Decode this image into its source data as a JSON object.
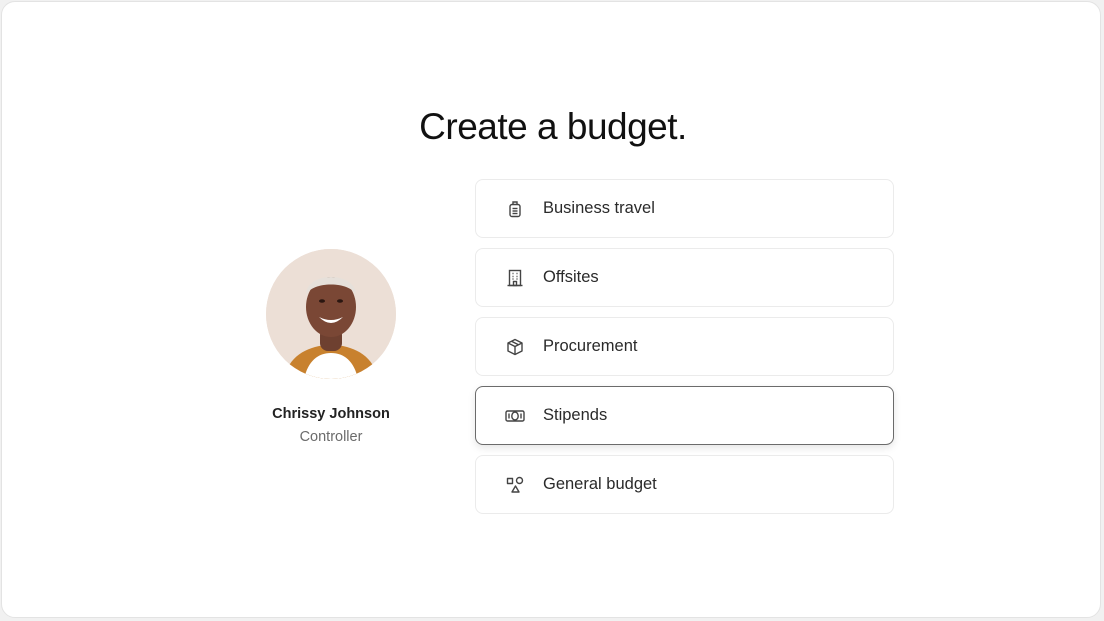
{
  "page": {
    "title": "Create a budget."
  },
  "profile": {
    "name": "Chrissy Johnson",
    "role": "Controller"
  },
  "options": [
    {
      "label": "Business travel",
      "icon": "luggage-icon",
      "selected": false
    },
    {
      "label": "Offsites",
      "icon": "building-icon",
      "selected": false
    },
    {
      "label": "Procurement",
      "icon": "box-icon",
      "selected": false
    },
    {
      "label": "Stipends",
      "icon": "cash-icon",
      "selected": true
    },
    {
      "label": "General budget",
      "icon": "shapes-icon",
      "selected": false
    }
  ],
  "colors": {
    "background": "#ffffff",
    "border": "#ebebeb",
    "selected_border": "#6b6b6b",
    "text": "#2a2a2a"
  }
}
